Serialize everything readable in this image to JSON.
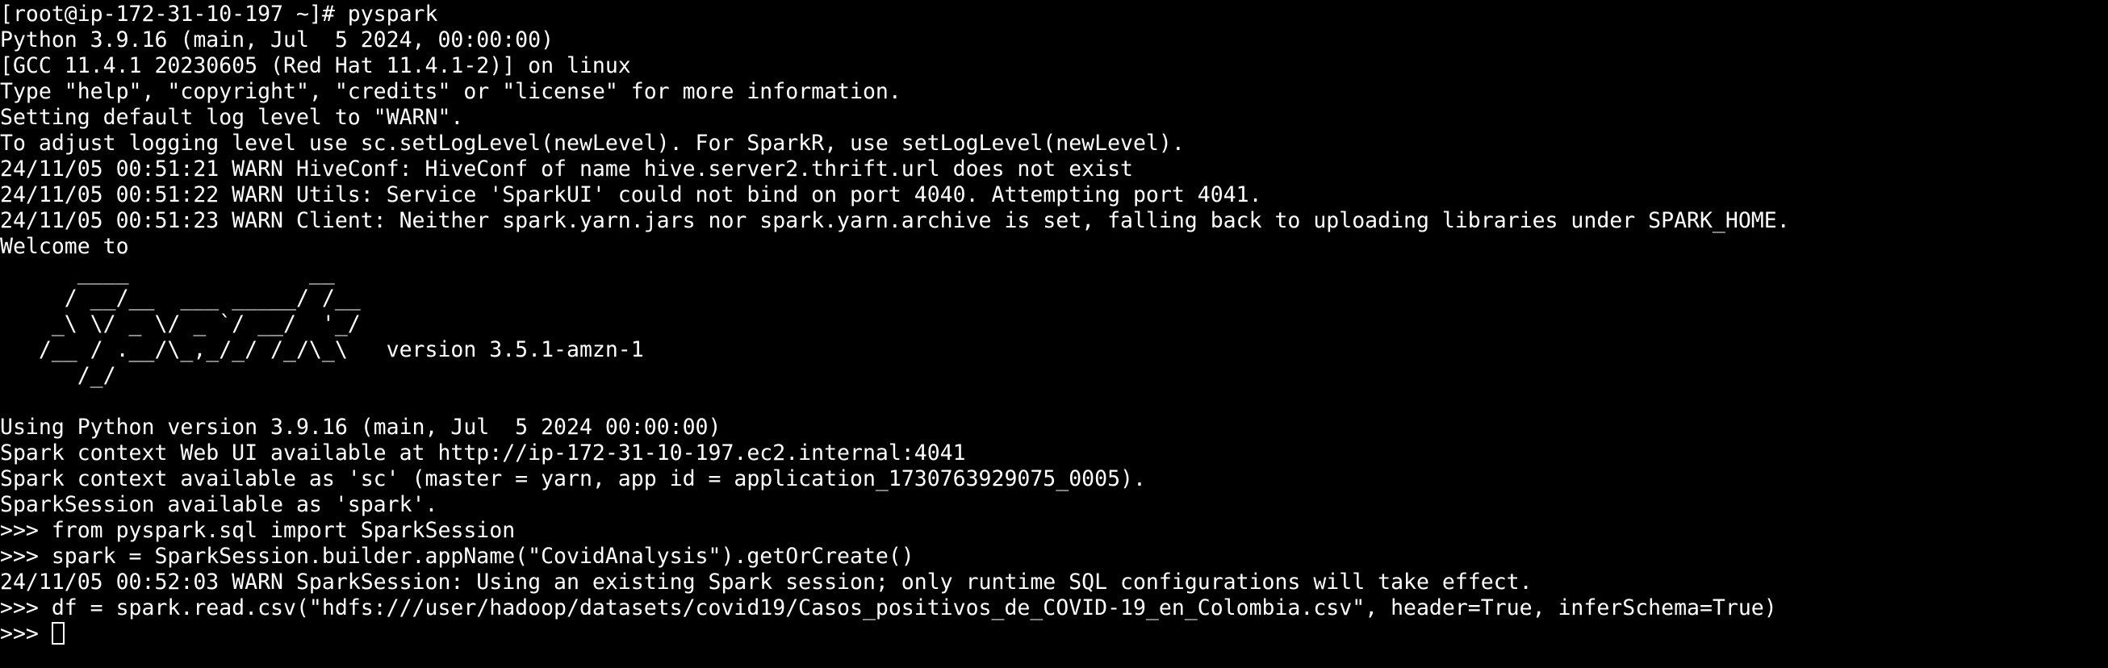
{
  "terminal": {
    "background": "#000000",
    "foreground": "#ffffff",
    "lines": [
      "[root@ip-172-31-10-197 ~]# pyspark",
      "Python 3.9.16 (main, Jul  5 2024, 00:00:00)",
      "[GCC 11.4.1 20230605 (Red Hat 11.4.1-2)] on linux",
      "Type \"help\", \"copyright\", \"credits\" or \"license\" for more information.",
      "Setting default log level to \"WARN\".",
      "To adjust logging level use sc.setLogLevel(newLevel). For SparkR, use setLogLevel(newLevel).",
      "24/11/05 00:51:21 WARN HiveConf: HiveConf of name hive.server2.thrift.url does not exist",
      "24/11/05 00:51:22 WARN Utils: Service 'SparkUI' could not bind on port 4040. Attempting port 4041.",
      "24/11/05 00:51:23 WARN Client: Neither spark.yarn.jars nor spark.yarn.archive is set, falling back to uploading libraries under SPARK_HOME.",
      "Welcome to",
      "      ____              __",
      "     / __/__  ___ _____/ /__",
      "    _\\ \\/ _ \\/ _ `/ __/  '_/",
      "   /__ / .__/\\_,_/_/ /_/\\_\\   version 3.5.1-amzn-1",
      "      /_/",
      "",
      "Using Python version 3.9.16 (main, Jul  5 2024 00:00:00)",
      "Spark context Web UI available at http://ip-172-31-10-197.ec2.internal:4041",
      "Spark context available as 'sc' (master = yarn, app id = application_1730763929075_0005).",
      "SparkSession available as 'spark'.",
      ">>> from pyspark.sql import SparkSession",
      ">>> spark = SparkSession.builder.appName(\"CovidAnalysis\").getOrCreate()",
      "24/11/05 00:52:03 WARN SparkSession: Using an existing Spark session; only runtime SQL configurations will take effect.",
      ">>> df = spark.read.csv(\"hdfs:///user/hadoop/datasets/covid19/Casos_positivos_de_COVID-19_en_Colombia.csv\", header=True, inferSchema=True)"
    ],
    "prompt": ">>> ",
    "input_value": ""
  }
}
